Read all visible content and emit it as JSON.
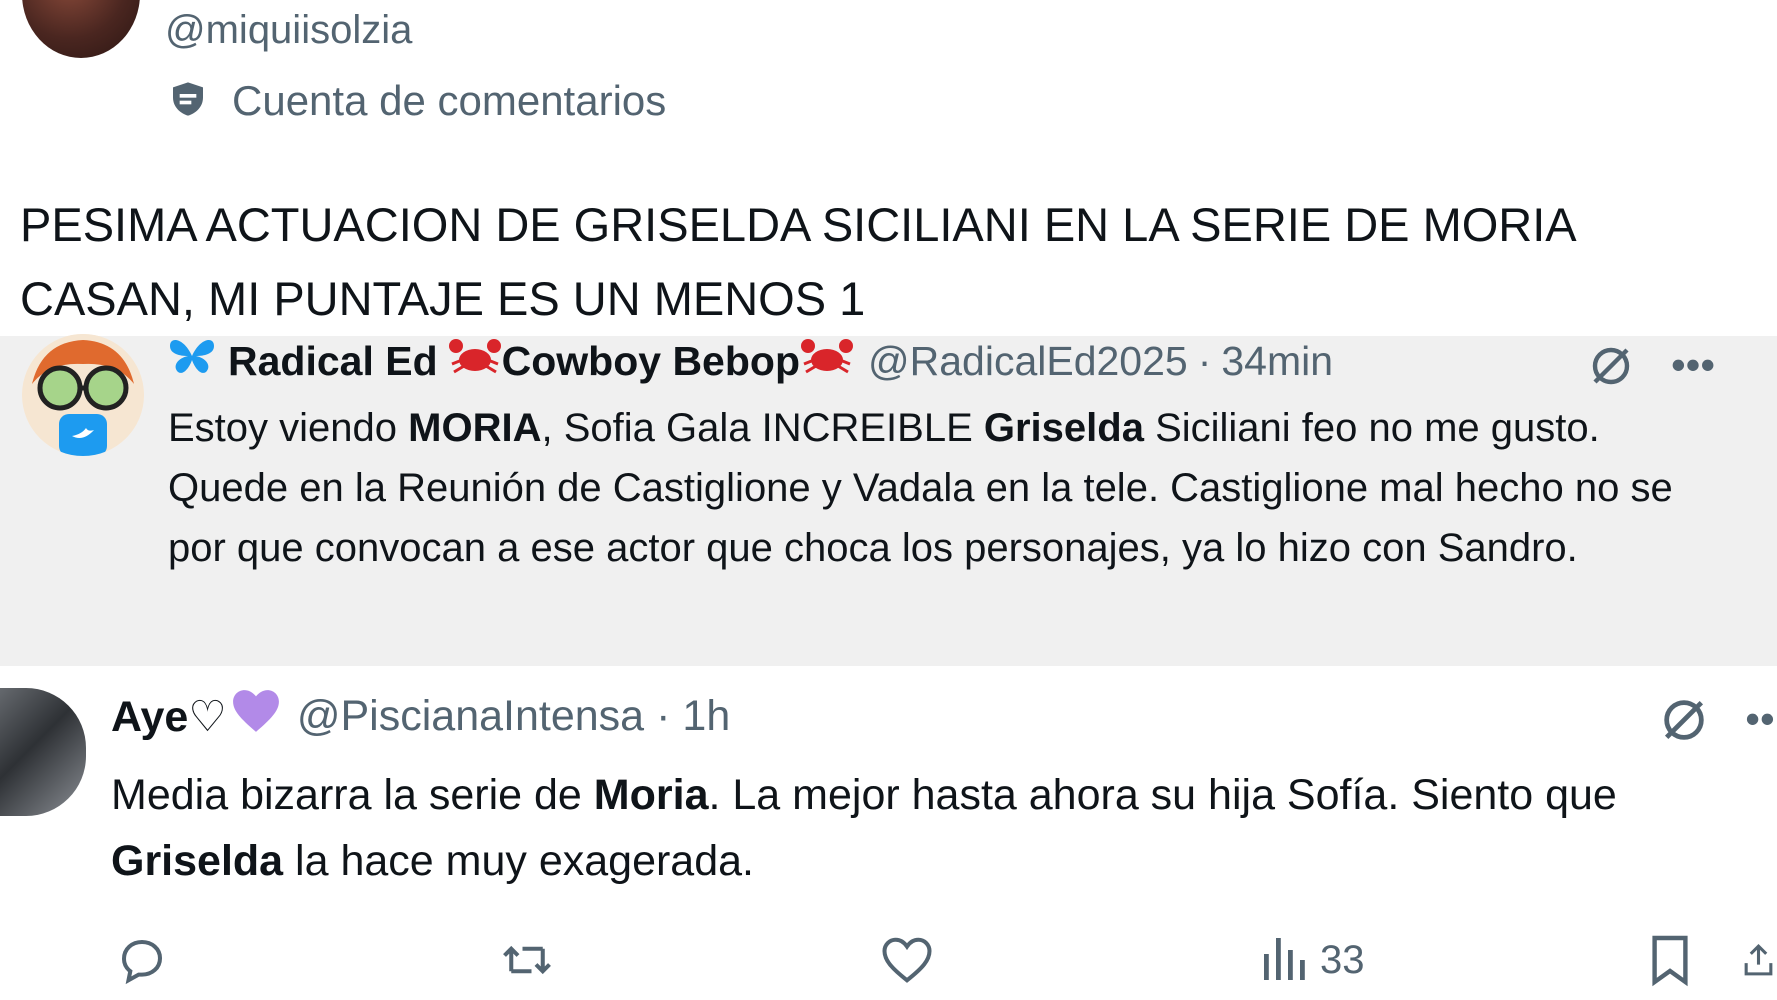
{
  "header": {
    "handle": "@miquiisolzia",
    "account_label": "Cuenta de comentarios",
    "account_icon": "shield-icon"
  },
  "post": {
    "text_line1": "PESIMA ACTUACION DE GRISELDA SICILIANI EN LA SERIE DE MORIA",
    "text_line2": "CASAN, MI PUNTAJE ES UN MENOS 1"
  },
  "quote": {
    "name_prefix": "Radical Ed",
    "name_suffix": "Cowboy Bebop",
    "handle": "@RadicalEd2025",
    "separator": "·",
    "time": "34min",
    "text": [
      {
        "t": "Estoy viendo ",
        "b": false
      },
      {
        "t": "MORIA",
        "b": true
      },
      {
        "t": ", Sofia Gala INCREIBLE ",
        "b": false
      },
      {
        "t": "Griselda",
        "b": true
      },
      {
        "t": " Siciliani feo no me gusto. Quede en la Reunión de Castiglione y Vadala en la tele. Castiglione mal hecho no se por que convocan a ese actor que choca los personajes, ya lo hizo con Sandro.",
        "b": false
      }
    ]
  },
  "reply": {
    "name": "Aye♡",
    "handle": "@PiscianaIntensa",
    "separator": "·",
    "time": "1h",
    "text": [
      {
        "t": "Media bizarra la serie de ",
        "b": false
      },
      {
        "t": "Moria",
        "b": true
      },
      {
        "t": ". La mejor hasta ahora su hija Sofía. Siento que ",
        "b": false
      },
      {
        "t": "Griselda",
        "b": true
      },
      {
        "t": " la hace muy exagerada.",
        "b": false
      }
    ],
    "views": "33"
  },
  "colors": {
    "muted": "#536471",
    "quote_bg": "#f0f0f0",
    "crab": "#e0245e",
    "butterfly": "#1d9bf0",
    "heart_purple": "#b28ae8"
  }
}
